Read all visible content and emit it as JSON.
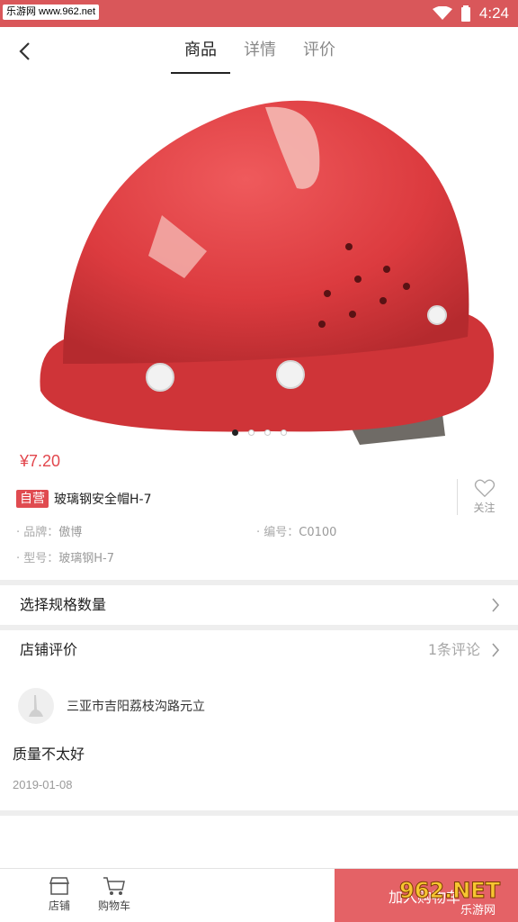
{
  "status_bar": {
    "watermark": "乐游网 www.962.net",
    "time": "4:24"
  },
  "nav": {
    "tabs": [
      "商品",
      "详情",
      "评价"
    ],
    "active_tab": 0
  },
  "carousel": {
    "count": 4,
    "active": 0
  },
  "product": {
    "price": "¥7.20",
    "badge": "自营",
    "title": "玻璃钢安全帽H-7",
    "follow_label": "关注",
    "brand_key": "品牌：",
    "brand": "傲博",
    "code_key": "编号：",
    "code": "C0100",
    "model_key": "型号：",
    "model": "玻璃钢H-7"
  },
  "spec_row": {
    "label": "选择规格数量"
  },
  "reviews": {
    "label": "店铺评价",
    "count": "1条评论",
    "items": [
      {
        "user": "三亚市吉阳荔枝沟路元立",
        "text": "质量不太好",
        "date": "2019-01-08"
      }
    ]
  },
  "bottom_bar": {
    "store_label": "店铺",
    "cart_label": "购物车",
    "add_cart": "加入购物车",
    "watermark_text": "962.NET",
    "watermark_sub": "乐游网"
  },
  "colors": {
    "accent": "#d9575a",
    "price": "#e2474d",
    "helmet": "#dd3b3e"
  }
}
